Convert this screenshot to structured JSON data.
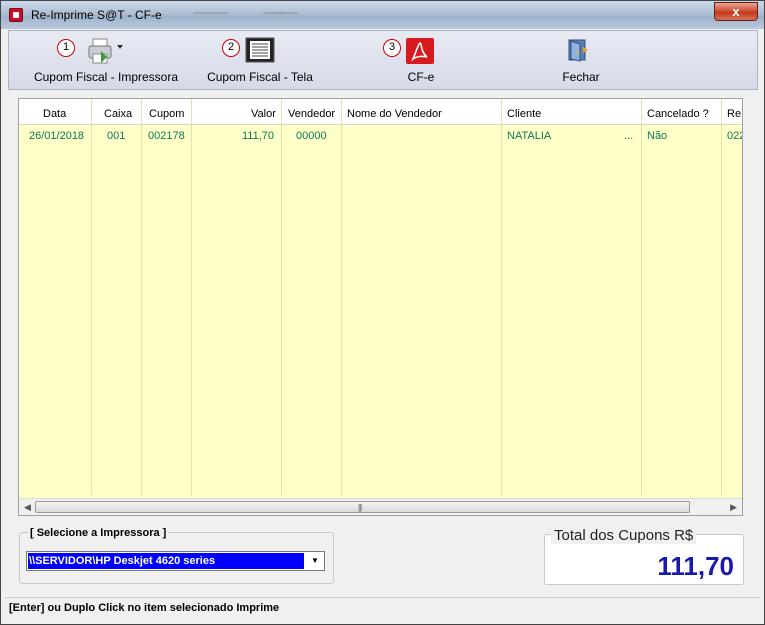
{
  "window": {
    "title": "Re-Imprime S@T - CF-e",
    "close_label": "x"
  },
  "toolbar": {
    "buttons": [
      {
        "number": "1",
        "label": "Cupom Fiscal - Impressora",
        "icon": "printer-icon"
      },
      {
        "number": "2",
        "label": "Cupom Fiscal - Tela",
        "icon": "screen-icon"
      },
      {
        "number": "3",
        "label": "CF-e",
        "icon": "pdf-icon"
      },
      {
        "number": "",
        "label": "Fechar",
        "icon": "exit-door-icon"
      }
    ]
  },
  "table": {
    "headers": [
      "Data",
      "Caixa",
      "Cupom",
      "Valor",
      "Vendedor",
      "Nome do Vendedor",
      "Cliente",
      "Cancelado ?",
      "Re"
    ],
    "rows": [
      {
        "data": "26/01/2018",
        "caixa": "001",
        "cupom": "002178",
        "valor": "111,70",
        "vendedor": "00000",
        "nome_vendedor": "",
        "cliente": "NATALIA",
        "cliente_more": "...",
        "cancelado": "Não",
        "re": "022"
      }
    ]
  },
  "printer": {
    "legend": "[ Selecione a Impressora ]",
    "selected": "\\\\SERVIDOR\\HP Deskjet 4620 series"
  },
  "total": {
    "label": "Total dos Cupons R$",
    "value": "111,70"
  },
  "status": {
    "text": "[Enter] ou Duplo Click no item selecionado Imprime"
  },
  "colors": {
    "row_bg": "#ffffc8",
    "row_text": "#0c7a5a",
    "selection": "#0000ff",
    "total_value": "#1a1aaa"
  }
}
